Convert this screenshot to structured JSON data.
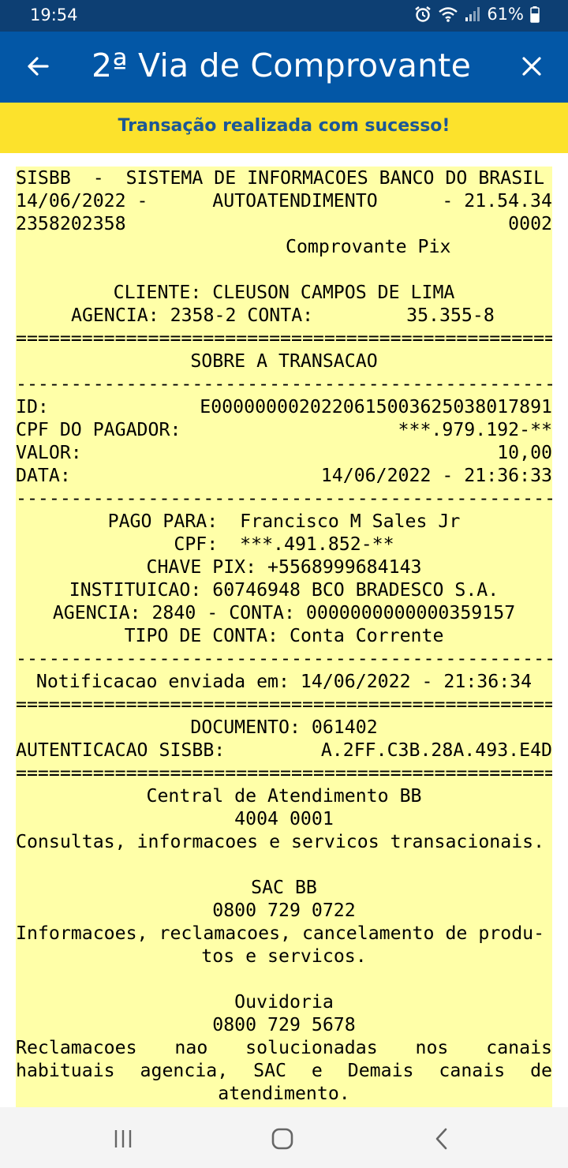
{
  "status_bar": {
    "time": "19:54",
    "battery": "61%",
    "icons": [
      "alarm-icon",
      "wifi-icon",
      "signal-icon",
      "battery-icon"
    ]
  },
  "app_bar": {
    "title": "2ª Via de Comprovante"
  },
  "success_message": "Transação realizada com sucesso!",
  "receipt": {
    "header": {
      "system_name": "SISBB  -  SISTEMA DE INFORMACOES BANCO DO BRASIL",
      "date_left": "14/06/2022 -",
      "channel": "AUTOATENDIMENTO",
      "time_right": "- 21.54.34",
      "terminal": "2358202358",
      "sequence": "0002",
      "doc_title": "Comprovante Pix"
    },
    "client": {
      "name_line": "CLIENTE: CLEUSON CAMPOS DE LIMA",
      "agency_label": "AGENCIA: 2358-2 CONTA:",
      "account": "35.355-8"
    },
    "rule_double": "==================================================",
    "rule_single": "--------------------------------------------------",
    "section_title": "SOBRE A TRANSACAO",
    "transaction": {
      "id_label": "ID:",
      "id_value": "E00000000202206150036250380178 91",
      "id": "E0000000020220615003625038017891",
      "payer_label": "CPF DO PAGADOR:",
      "payer_value": "***.979.192-**",
      "value_label": "VALOR:",
      "value": "10,00",
      "date_label": "DATA:",
      "date_value": "14/06/2022 - 21:36:33"
    },
    "payee": {
      "paid_to": "PAGO PARA:  Francisco M Sales Jr",
      "cpf": "CPF:  ***.491.852-**",
      "pix_key": "CHAVE PIX: +5568999684143",
      "institution": "INSTITUICAO: 60746948 BCO BRADESCO S.A.",
      "agency_account": "AGENCIA: 2840 - CONTA: 0000000000000359157",
      "account_type": "TIPO DE CONTA: Conta Corrente"
    },
    "notification": "Notificacao enviada em: 14/06/2022 - 21:36:34",
    "document": "DOCUMENTO: 061402",
    "auth_label": "AUTENTICACAO SISBB:",
    "auth_value": "A.2FF.C3B.28A.493.E4D",
    "central": {
      "title": "Central de Atendimento BB",
      "phone": "4004 0001",
      "description": "Consultas, informacoes e servicos transacionais."
    },
    "sac": {
      "title": "SAC BB",
      "phone": "0800 729 0722",
      "description_line1": "Informacoes, reclamacoes, cancelamento de produ-",
      "description_line2": "tos e servicos."
    },
    "ouvidoria": {
      "title": "Ouvidoria",
      "phone": "0800 729 5678",
      "description_line1": "Reclamacoes nao solucionadas nos canais",
      "description_line2": "habituais agencia, SAC e Demais canais de",
      "description_line3": "atendimento."
    }
  },
  "nav_bar": {
    "buttons": [
      "recent-apps-icon",
      "home-icon",
      "back-icon"
    ]
  }
}
